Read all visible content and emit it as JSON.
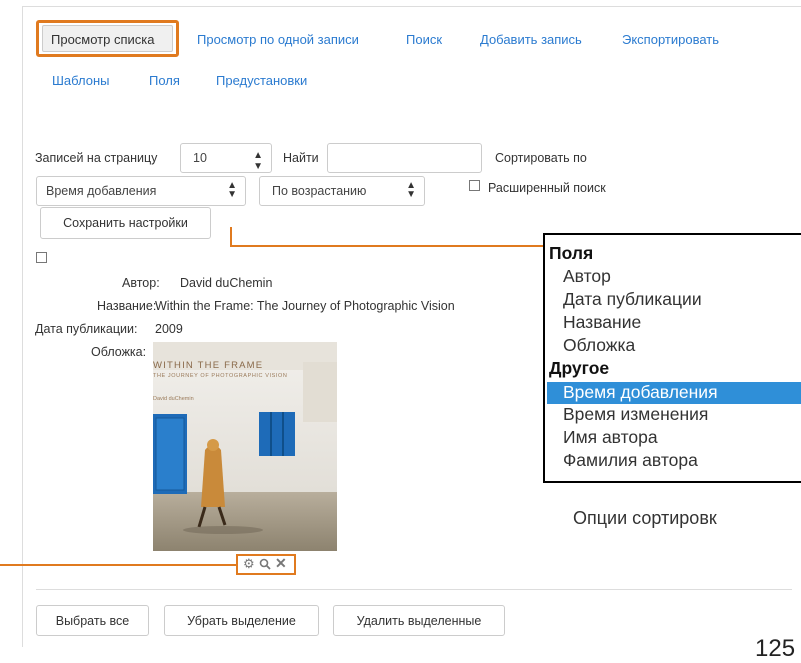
{
  "tabs": {
    "list_view": "Просмотр списка",
    "single_view": "Просмотр по одной записи",
    "search": "Поиск",
    "add": "Добавить запись",
    "export": "Экспортировать",
    "templates": "Шаблоны",
    "fields": "Поля",
    "presets": "Предустановки"
  },
  "controls": {
    "per_page_label": "Записей на страницу",
    "per_page_value": "10",
    "find_label": "Найти",
    "find_value": "",
    "sort_label": "Сортировать по",
    "sort_field": "Время добавления",
    "sort_order": "По возрастанию",
    "advanced_search": "Расширенный поиск",
    "save_settings": "Сохранить настройки"
  },
  "record": {
    "author_label": "Автор:",
    "author_value": "David duChemin",
    "title_label": "Название:",
    "title_value": "Within the Frame: The Journey of Photographic Vision",
    "date_label": "Дата публикации:",
    "date_value": "2009",
    "cover_label": "Обложка:",
    "cover_title": "WITHIN THE FRAME",
    "cover_subtitle": "THE JOURNEY OF PHOTOGRAPHIC VISION",
    "cover_author": "David duChemin",
    "action_icons": [
      "gear-icon",
      "search-icon",
      "close-icon"
    ]
  },
  "bottom_buttons": {
    "select_all": "Выбрать все",
    "deselect": "Убрать выделение",
    "delete_selected": "Удалить выделенные"
  },
  "sort_popup": {
    "group_fields": "Поля",
    "fields": [
      "Автор",
      "Дата публикации",
      "Название",
      "Обложка"
    ],
    "group_other": "Другое",
    "other": [
      "Время добавления",
      "Время изменения",
      "Имя автора",
      "Фамилия автора"
    ],
    "selected": "Время добавления"
  },
  "caption": "Опции сортировк",
  "page_number": "125",
  "colors": {
    "accent_orange": "#e07a1f",
    "link_blue": "#2b7bd0",
    "selection_blue": "#2f8fd8"
  }
}
